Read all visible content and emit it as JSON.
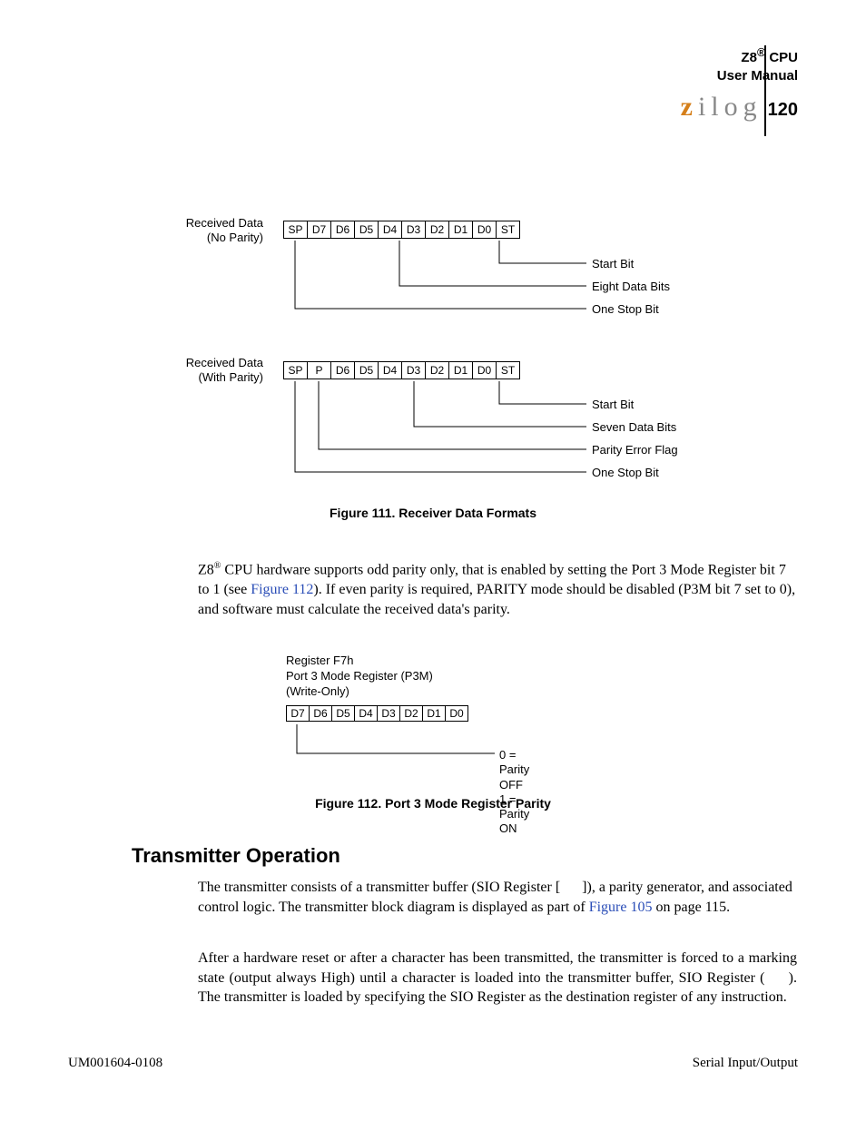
{
  "header": {
    "product_line1": "Z8",
    "reg": "®",
    "product_line1b": " CPU",
    "product_line2": "User Manual",
    "logo_text": "ilog",
    "logo_z": "z",
    "page_number": "120"
  },
  "fig111": {
    "label_noparity_l1": "Received Data",
    "label_noparity_l2": "(No Parity)",
    "row1_bits": [
      "SP",
      "D7",
      "D6",
      "D5",
      "D4",
      "D3",
      "D2",
      "D1",
      "D0",
      "ST"
    ],
    "row1_callouts": [
      "Start Bit",
      "Eight Data Bits",
      "One Stop Bit"
    ],
    "label_withparity_l1": "Received Data",
    "label_withparity_l2": "(With Parity)",
    "row2_bits": [
      "SP",
      "P",
      "D6",
      "D5",
      "D4",
      "D3",
      "D2",
      "D1",
      "D0",
      "ST"
    ],
    "row2_callouts": [
      "Start Bit",
      "Seven Data Bits",
      "Parity Error Flag",
      "One Stop Bit"
    ],
    "caption": "Figure 111. Receiver Data Formats"
  },
  "para1_a": "Z8",
  "para1_reg": "®",
  "para1_b": " CPU hardware supports odd parity only, that is enabled by setting the Port 3 Mode Register bit 7 to 1 (see ",
  "para1_link": "Figure 112",
  "para1_c": "). If even parity is required, PARITY mode should be disabled (P3M bit 7 set to 0), and software must calculate the received data's parity.",
  "fig112": {
    "hdr_l1": "Register F7h",
    "hdr_l2": "Port 3  Mode Register (P3M)",
    "hdr_l3": "(Write-Only)",
    "bits": [
      "D7",
      "D6",
      "D5",
      "D4",
      "D3",
      "D2",
      "D1",
      "D0"
    ],
    "parity_off": "0 = Parity OFF",
    "parity_on": "1 = Parity ON",
    "caption": "Figure 112. Port 3 Mode Register Parity"
  },
  "section_heading": "Transmitter Operation",
  "para2_a": "The transmitter consists of a transmitter buffer (SIO Register [      ]), a parity generator, and associated control logic. The transmitter block diagram is displayed as part of ",
  "para2_link": "Figure 105",
  "para2_b": " on page 115.",
  "para3": "After a hardware reset or after a character has been transmitted, the transmitter is forced to a marking state (output always High) until a character is loaded into the transmitter buffer, SIO Register (     ). The transmitter is loaded by specifying the SIO Register as the destination register of any instruction.",
  "footer": {
    "left": "UM001604-0108",
    "right": "Serial Input/Output"
  }
}
